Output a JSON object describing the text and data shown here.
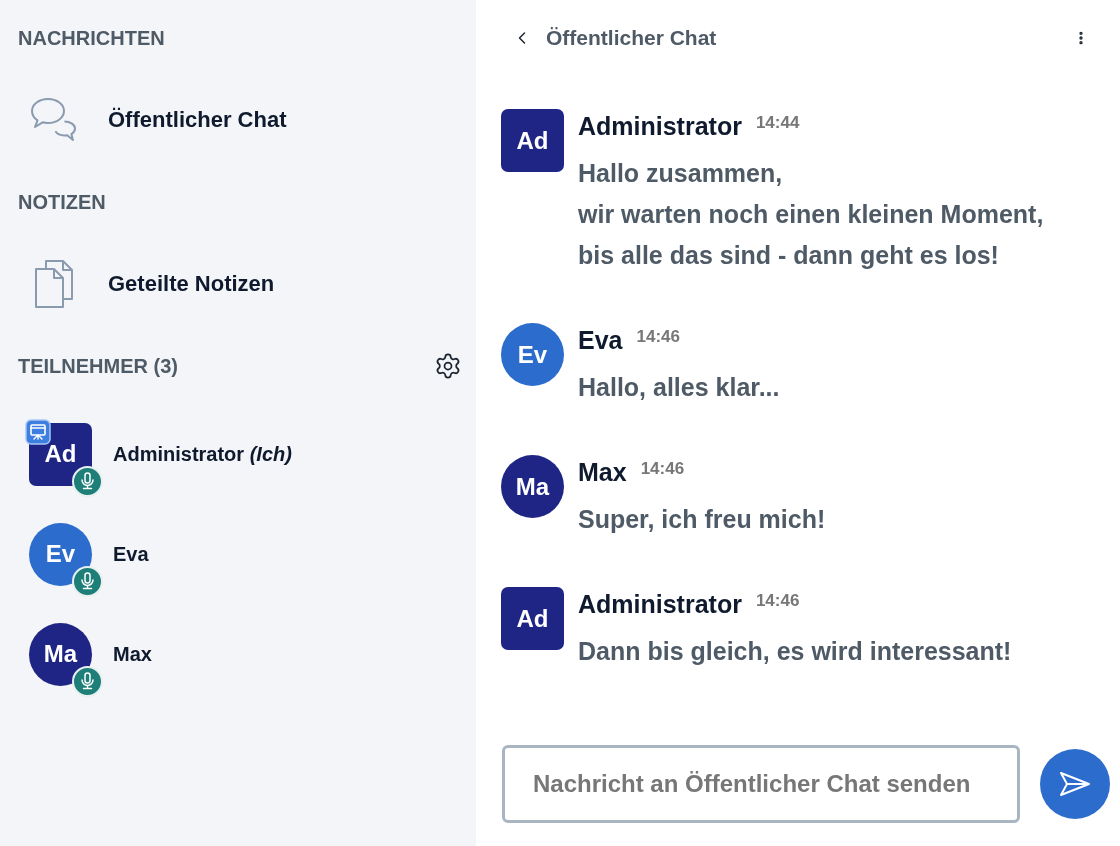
{
  "sidebar": {
    "messages_heading": "NACHRICHTEN",
    "chats": [
      {
        "label": "Öffentlicher Chat"
      }
    ],
    "notes_heading": "NOTIZEN",
    "notes": [
      {
        "label": "Geteilte Notizen"
      }
    ],
    "participants_heading": "TEILNEHMER (3)",
    "participants": [
      {
        "initials": "Ad",
        "name": "Administrator *(Ich)*",
        "kind": "square",
        "color": "#1f2585",
        "presenter": true,
        "audio": true
      },
      {
        "initials": "Ev",
        "name": "Eva",
        "kind": "round",
        "color": "#2b6ccd",
        "presenter": false,
        "audio": true
      },
      {
        "initials": "Ma",
        "name": "Max",
        "kind": "round",
        "color": "#1f2585",
        "presenter": false,
        "audio": true
      }
    ]
  },
  "chat": {
    "title": "Öffentlicher Chat",
    "messages": [
      {
        "initials": "Ad",
        "author": "Administrator",
        "time": "14:44",
        "kind": "square",
        "color": "#1f2585",
        "text": "Hallo zusammen,\nwir warten noch einen kleinen Moment,\nbis alle das sind - dann geht es los!"
      },
      {
        "initials": "Ev",
        "author": "Eva",
        "time": "14:46",
        "kind": "round",
        "color": "#2b6ccd",
        "text": "Hallo, alles klar..."
      },
      {
        "initials": "Ma",
        "author": "Max",
        "time": "14:46",
        "kind": "round",
        "color": "#1f2585",
        "text": "Super, ich freu mich!"
      },
      {
        "initials": "Ad",
        "author": "Administrator",
        "time": "14:46",
        "kind": "square",
        "color": "#1f2585",
        "text": "Dann bis gleich, es wird interessant!"
      }
    ],
    "input": {
      "placeholder": "Nachricht an Öffentlicher Chat senden"
    }
  }
}
